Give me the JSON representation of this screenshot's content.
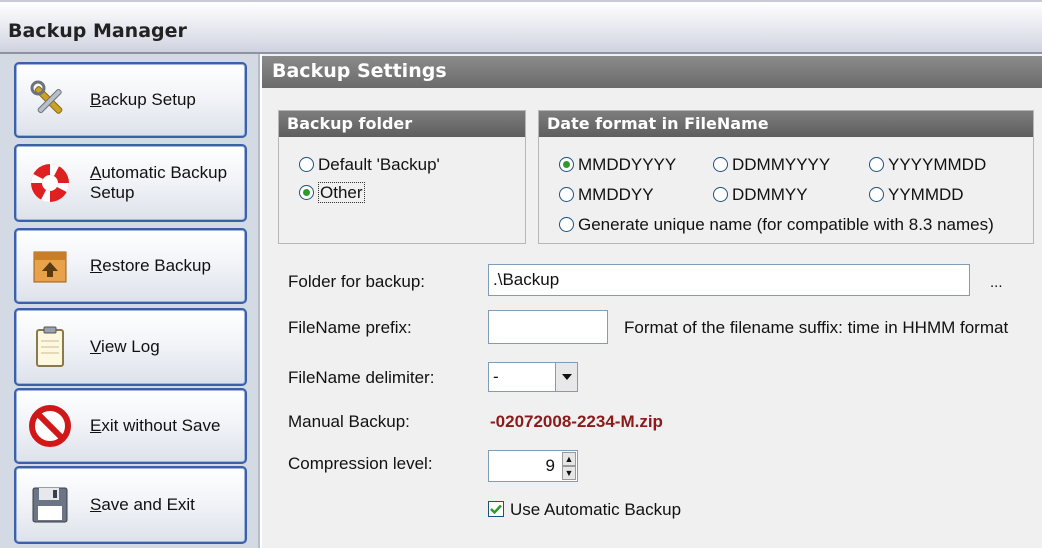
{
  "window": {
    "title": "Backup Manager"
  },
  "sidebar": {
    "items": [
      {
        "label_u": "B",
        "label_rest": "ackup Setup",
        "icon": "tools-icon"
      },
      {
        "label_u": "A",
        "label_rest": "utomatic Backup",
        "label_line2": "Setup",
        "icon": "lifebuoy-icon"
      },
      {
        "label_u": "R",
        "label_rest": "estore Backup",
        "icon": "box-restore-icon"
      },
      {
        "label_u": "V",
        "label_rest": "iew Log",
        "icon": "clipboard-icon"
      },
      {
        "label_u": "E",
        "label_rest": "xit without Save",
        "icon": "no-entry-icon"
      },
      {
        "label_u": "S",
        "label_rest": "ave and Exit",
        "icon": "floppy-disk-icon"
      }
    ]
  },
  "main": {
    "header": "Backup Settings",
    "backup_folder": {
      "title": "Backup folder",
      "options": [
        "Default 'Backup'",
        "Other"
      ],
      "selected": "Other"
    },
    "date_format": {
      "title": "Date format in FileName",
      "options": [
        "MMDDYYYY",
        "DDMMYYYY",
        "YYYYMMDD",
        "MMDDYY",
        "DDMMYY",
        "YYMMDD",
        "Generate unique name (for compatible with 8.3 names)"
      ],
      "selected": "MMDDYYYY"
    },
    "fields": {
      "folder_label": "Folder for backup:",
      "folder_value": ".\\Backup",
      "browse_label": "...",
      "prefix_label": "FileName prefix:",
      "prefix_value": "",
      "suffix_note": "Format of the filename suffix: time in HHMM format",
      "delimiter_label": "FileName delimiter:",
      "delimiter_value": "-",
      "manual_label": "Manual Backup:",
      "manual_value": "-02072008-2234-M.zip",
      "compression_label": "Compression level:",
      "compression_value": "9",
      "auto_backup_label": "Use Automatic Backup",
      "auto_backup_checked": true
    }
  },
  "colors": {
    "button_border": "#3a61a8",
    "header_gray": "#6b6b6b",
    "manual_red": "#8b1a1a",
    "radio_green": "#2b9b2b"
  }
}
